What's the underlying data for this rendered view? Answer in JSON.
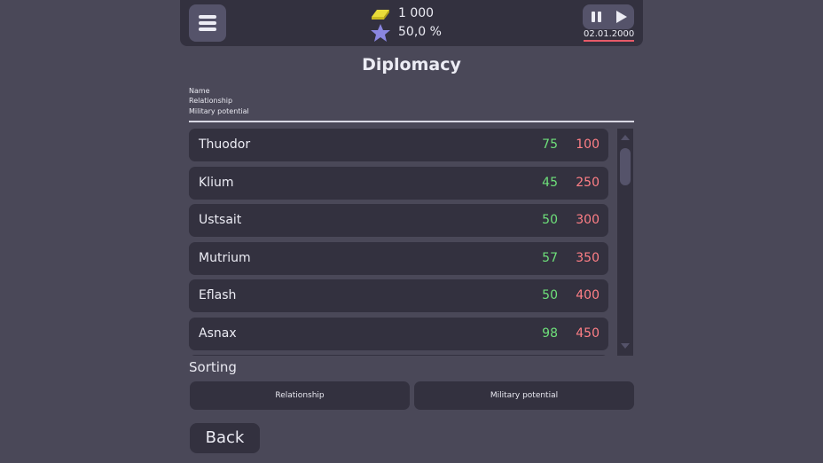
{
  "top": {
    "gold": "1 000",
    "prestige": "50,0 %",
    "date": "02.01.2000"
  },
  "title": "Diplomacy",
  "columns": [
    "Name",
    "Relationship",
    "Military potential"
  ],
  "rows": [
    {
      "name": "Thuodor",
      "relationship": "75",
      "military": "100"
    },
    {
      "name": "Klium",
      "relationship": "45",
      "military": "250"
    },
    {
      "name": "Ustsait",
      "relationship": "50",
      "military": "300"
    },
    {
      "name": "Mutrium",
      "relationship": "57",
      "military": "350"
    },
    {
      "name": "Eflash",
      "relationship": "50",
      "military": "400"
    },
    {
      "name": "Asnax",
      "relationship": "98",
      "military": "450"
    }
  ],
  "sorting": {
    "label": "Sorting",
    "options": [
      "Relationship",
      "Military potential"
    ]
  },
  "back_label": "Back",
  "colors": {
    "background": "#4a4858",
    "panel": "#33313f",
    "positive": "#6ee07a",
    "negative": "#ff7f86",
    "date_underline": "#e85a68"
  },
  "icons": {
    "menu": "hamburger-menu-icon",
    "gold": "gold-bar-icon",
    "prestige": "star-icon",
    "pause": "pause-icon",
    "play": "play-icon"
  }
}
